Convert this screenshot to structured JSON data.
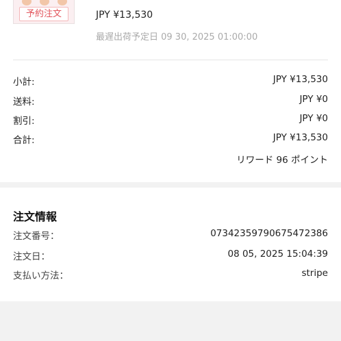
{
  "item": {
    "tag": "予約注文",
    "price": "JPY ¥13,530",
    "ship_date": "最遅出荷予定日 09 30, 2025 01:00:00"
  },
  "summary": {
    "subtotal_label": "小計:",
    "subtotal_value": "JPY ¥13,530",
    "shipping_label": "送料:",
    "shipping_value": "JPY ¥0",
    "discount_label": "割引:",
    "discount_value": "JPY ¥0",
    "total_label": "合計:",
    "total_value": "JPY ¥13,530",
    "reward": "リワード 96 ポイント"
  },
  "order_info": {
    "title": "注文情報",
    "number_label": "注文番号：",
    "number_value": "07342359790675472386",
    "date_label": "注文日：",
    "date_value": "08 05, 2025 15:04:39",
    "payment_label": "支払い方法：",
    "payment_value": "stripe"
  }
}
